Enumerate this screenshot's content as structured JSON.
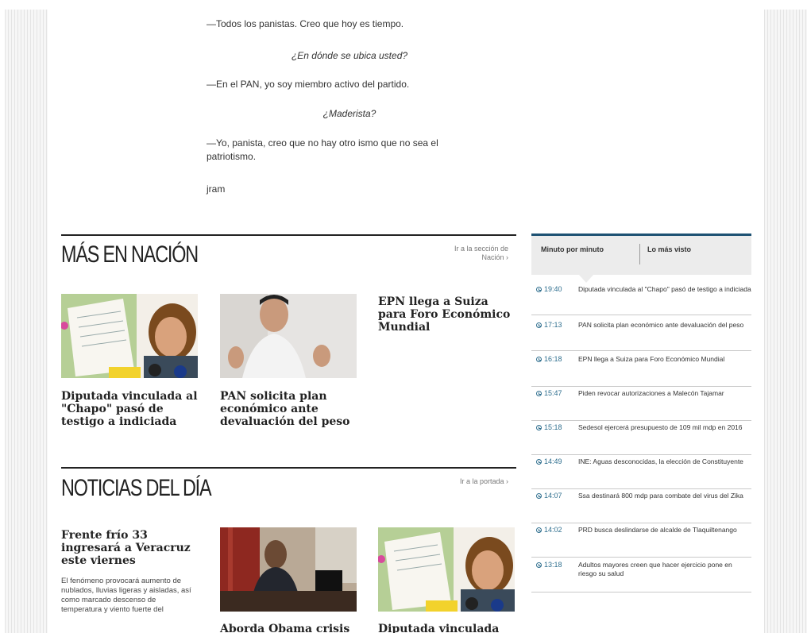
{
  "article": {
    "paragraphs": [
      "—Todos los panistas. Creo que hoy es tiempo.",
      "¿En dónde se ubica usted?",
      "—En el PAN, yo soy miembro activo del partido.",
      "¿Maderista?",
      "—Yo, panista, creo que no hay otro ismo que no sea el patriotismo.",
      "jram"
    ]
  },
  "mas_en_nacion": {
    "title": "MÁS EN NACIÓN",
    "link": "Ir a la sección de Nación ›",
    "items": [
      {
        "headline": "Diputada vinculada al \"Chapo\" pasó de testigo a indiciada"
      },
      {
        "headline": "PAN solicita plan económico ante devaluación del peso"
      },
      {
        "headline": "EPN llega a Suiza para Foro Económico Mundial"
      }
    ]
  },
  "noticias_del_dia": {
    "title": "NOTICIAS DEL DÍA",
    "link": "Ir a la portada ›",
    "items": [
      {
        "headline": "Frente frío 33 ingresará a Veracruz este viernes",
        "summary": "El fenómeno provocará aumento de nublados, lluvias ligeras y aisladas, así como marcado descenso de temperatura y viento fuerte del"
      },
      {
        "headline": "Aborda Obama crisis"
      },
      {
        "headline": "Diputada vinculada"
      }
    ]
  },
  "sidebar": {
    "tabs": [
      "Minuto por minuto",
      "Lo más visto"
    ],
    "accent_color": "#1e5273",
    "feed": [
      {
        "time": "19:40",
        "text": "Diputada vinculada al \"Chapo\" pasó de testigo a indiciada"
      },
      {
        "time": "17:13",
        "text": "PAN solicita plan económico ante devaluación del peso"
      },
      {
        "time": "16:18",
        "text": "EPN llega a Suiza para Foro Económico Mundial"
      },
      {
        "time": "15:47",
        "text": "Piden revocar autorizaciones a Malecón Tajamar"
      },
      {
        "time": "15:18",
        "text": "Sedesol ejercerá presupuesto de 109 mil mdp en 2016"
      },
      {
        "time": "14:49",
        "text": "INE: Aguas desconocidas, la elección de Constituyente"
      },
      {
        "time": "14:07",
        "text": "Ssa destinará 800 mdp para combate del virus del Zika"
      },
      {
        "time": "14:02",
        "text": "PRD busca deslindarse de alcalde de Tlaquiltenango"
      },
      {
        "time": "13:18",
        "text": "Adultos mayores creen que hacer ejercicio pone en riesgo su salud"
      }
    ]
  }
}
